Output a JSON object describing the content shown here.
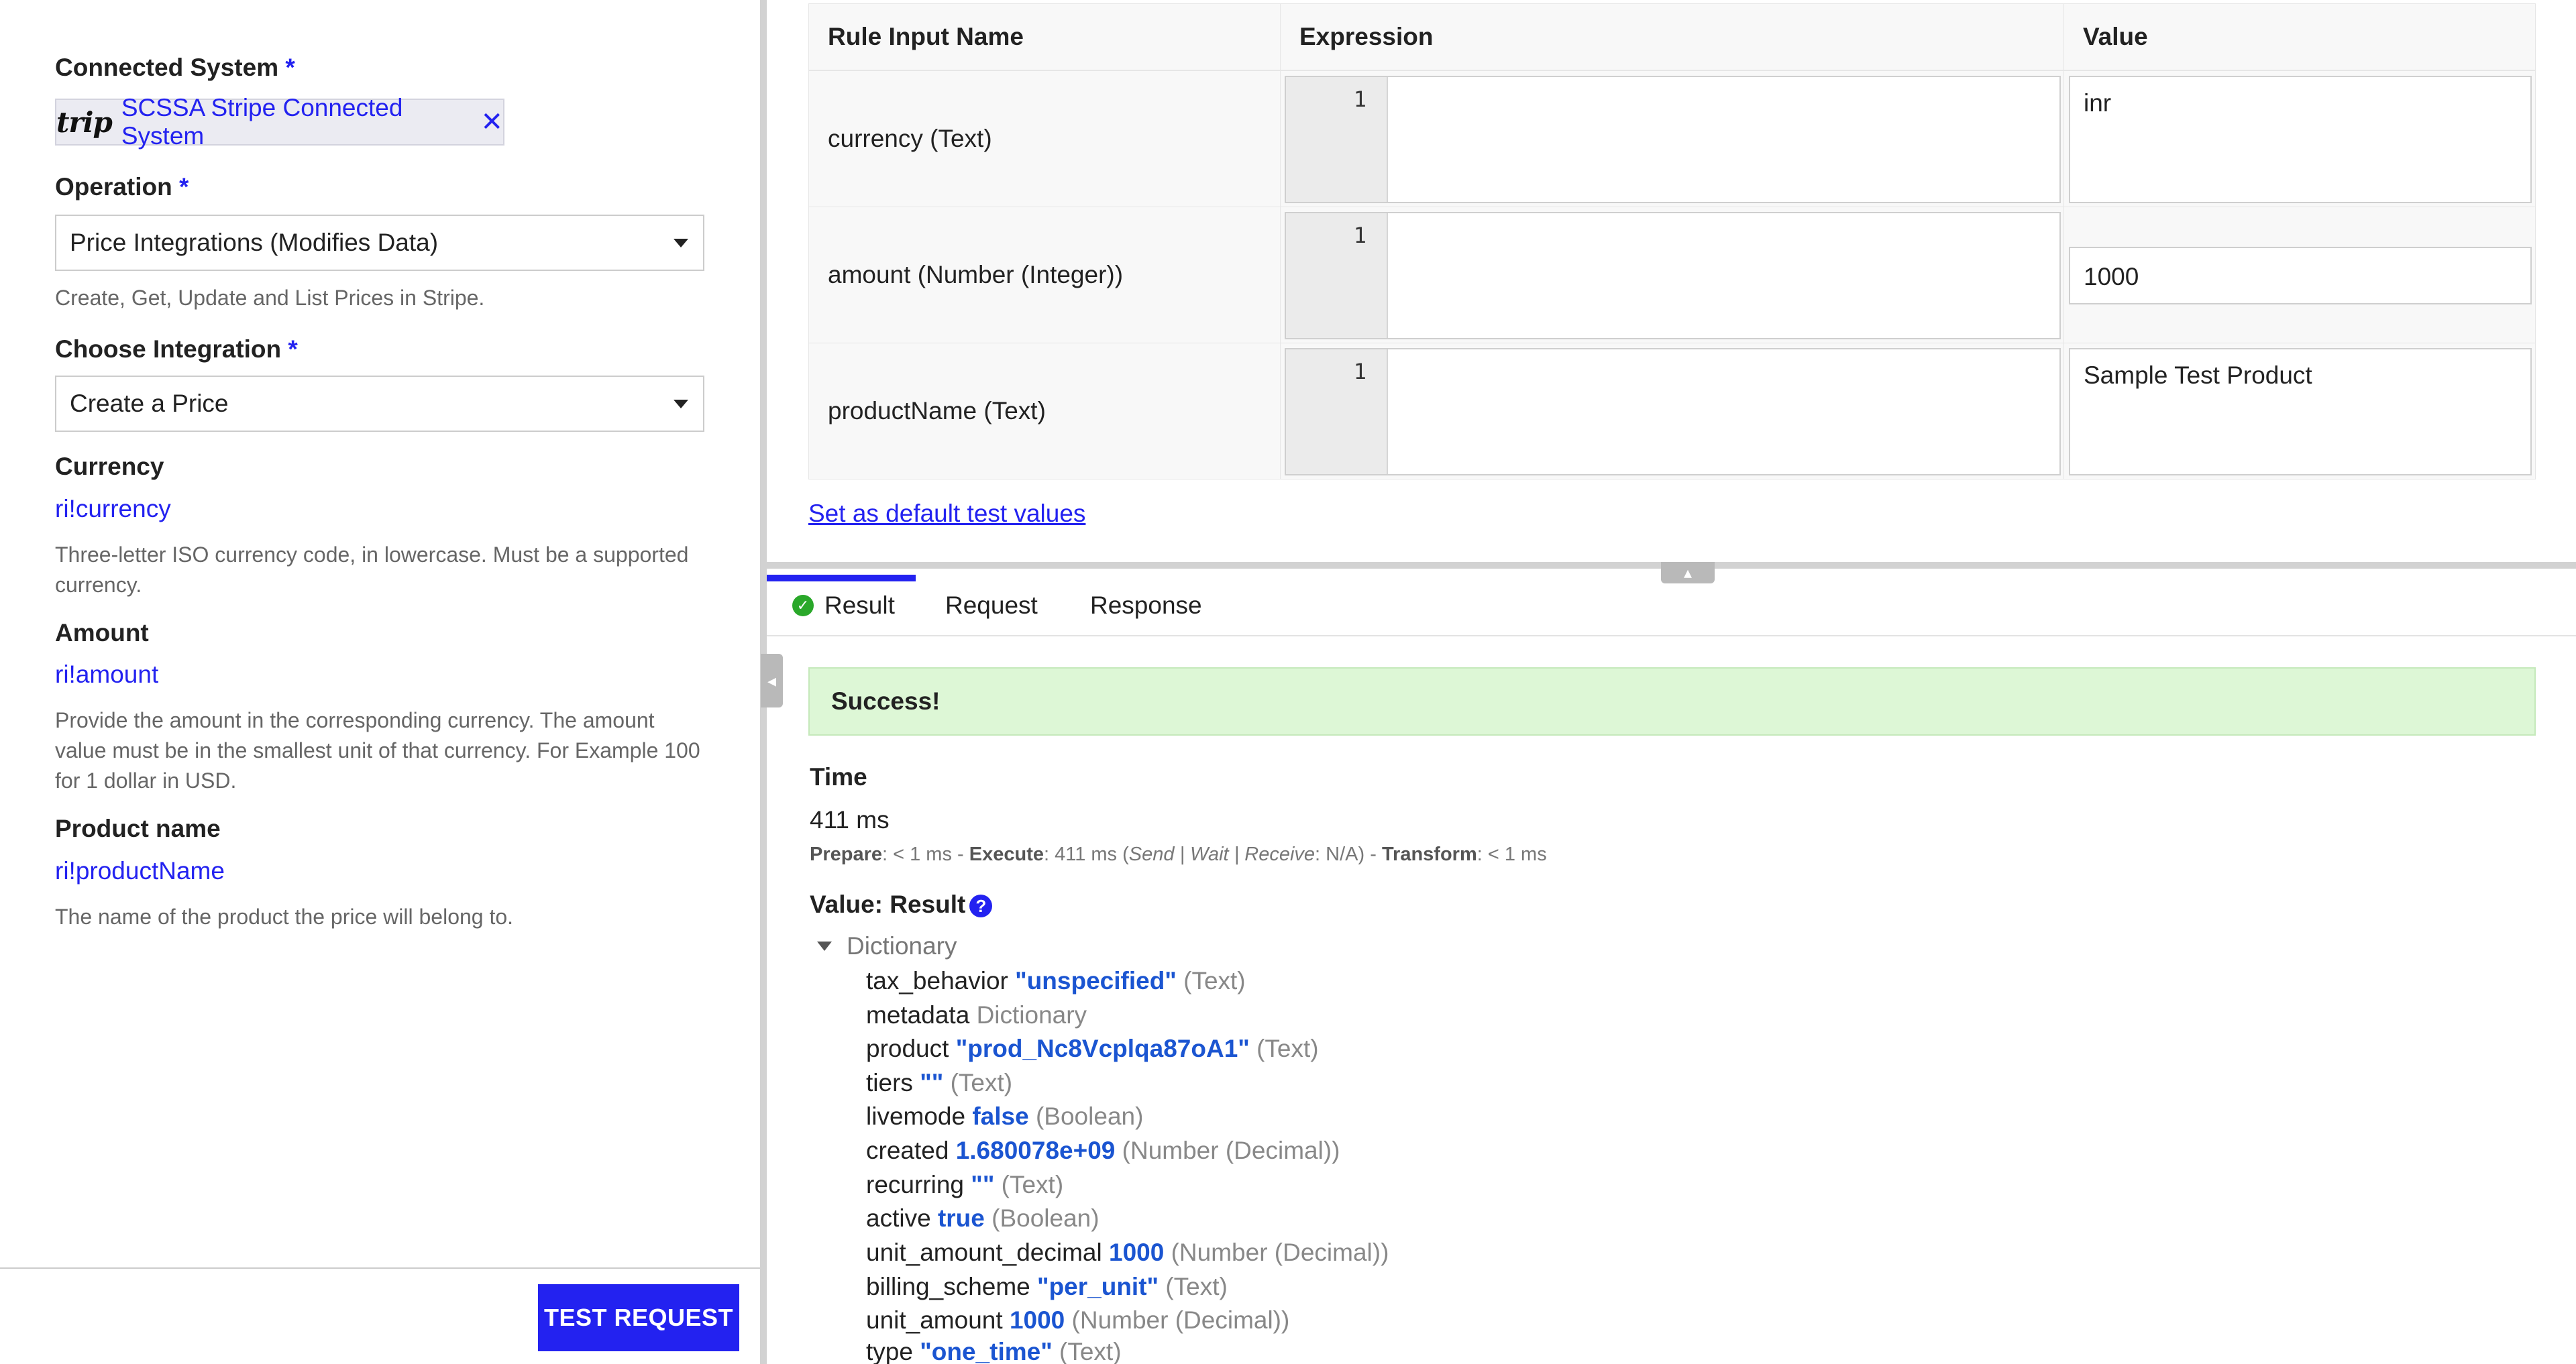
{
  "left": {
    "connected_system": {
      "label": "Connected System",
      "required": "*",
      "chip_logo": "trip",
      "chip_text": "SCSSA Stripe Connected System",
      "remove": "✕"
    },
    "operation": {
      "label": "Operation",
      "required": "*",
      "value": "Price Integrations (Modifies Data)",
      "help": "Create, Get, Update and List Prices in Stripe."
    },
    "choose_integration": {
      "label": "Choose Integration",
      "required": "*",
      "value": "Create a Price"
    },
    "currency": {
      "label": "Currency",
      "link": "ri!currency",
      "help": "Three-letter ISO currency code, in lowercase. Must be a supported currency."
    },
    "amount": {
      "label": "Amount",
      "link": "ri!amount",
      "help": "Provide the amount in the corresponding currency. The amount value must be in the smallest unit of that currency. For Example 100 for 1 dollar in USD."
    },
    "product_name": {
      "label": "Product name",
      "link": "ri!productName",
      "help": "The name of the product the price will belong to."
    },
    "test_button": "TEST REQUEST"
  },
  "rule_inputs": {
    "headers": [
      "Rule Input Name",
      "Expression",
      "Value"
    ],
    "rows": [
      {
        "name": "currency (Text)",
        "line": "1",
        "value": "inr"
      },
      {
        "name": "amount (Number (Integer))",
        "line": "1",
        "value": "1000"
      },
      {
        "name": "productName (Text)",
        "line": "1",
        "value": "Sample Test Product"
      }
    ],
    "default_link": "Set as default test values"
  },
  "tabs": [
    "Result",
    "Request",
    "Response"
  ],
  "result": {
    "status": "Success!",
    "time_label": "Time",
    "time_value": "411 ms",
    "timing": {
      "prepare_label": "Prepare",
      "prepare_value": ": < 1 ms - ",
      "execute_label": "Execute",
      "execute_value": ": 411 ms (",
      "send_wait_receive": "Send | Wait | Receive",
      "swr_value": ": N/A) - ",
      "transform_label": "Transform",
      "transform_value": ": < 1 ms"
    },
    "value_label": "Value: Result",
    "help_icon": "?",
    "dict_label": "Dictionary",
    "entries": [
      {
        "key": "tax_behavior",
        "value": "\"unspecified\"",
        "type": "(Text)"
      },
      {
        "key": "metadata",
        "value": "",
        "type": "Dictionary"
      },
      {
        "key": "product",
        "value": "\"prod_Nc8Vcplqa87oA1\"",
        "type": "(Text)"
      },
      {
        "key": "tiers",
        "value": "\"\"",
        "type": "(Text)"
      },
      {
        "key": "livemode",
        "value": "false",
        "type": "(Boolean)"
      },
      {
        "key": "created",
        "value": "1.680078e+09",
        "type": "(Number (Decimal))"
      },
      {
        "key": "recurring",
        "value": "\"\"",
        "type": "(Text)"
      },
      {
        "key": "active",
        "value": "true",
        "type": "(Boolean)"
      },
      {
        "key": "unit_amount_decimal",
        "value": "1000",
        "type": "(Number (Decimal))"
      },
      {
        "key": "billing_scheme",
        "value": "\"per_unit\"",
        "type": "(Text)"
      },
      {
        "key": "unit_amount",
        "value": "1000",
        "type": "(Number (Decimal))"
      },
      {
        "key": "type",
        "value": "\"one_time\"",
        "type": "(Text)"
      }
    ]
  },
  "colors": {
    "accent": "#2322f0",
    "success_bg": "#ddf7d6",
    "value_blue": "#1b55d1"
  }
}
